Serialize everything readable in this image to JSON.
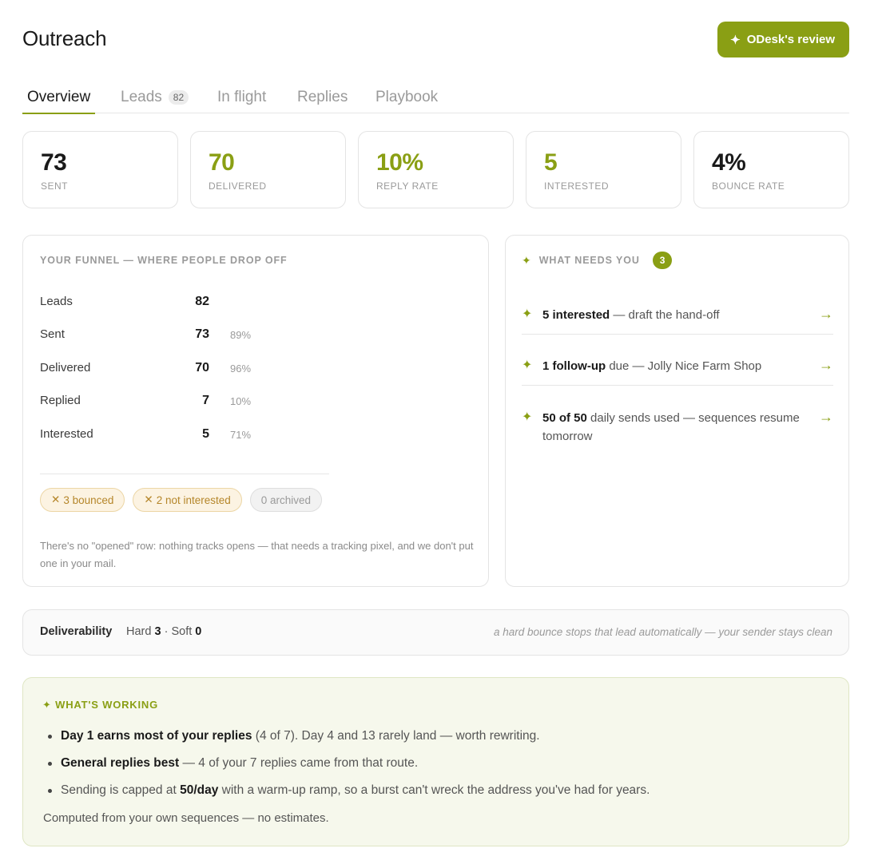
{
  "header": {
    "title": "Outreach",
    "review_button": {
      "icon": "sparkle-icon",
      "icon_glyph": "✦",
      "label": "ODesk's review"
    }
  },
  "tabs": [
    {
      "label": "Overview",
      "active": true
    },
    {
      "label": "Leads",
      "badge": "82"
    },
    {
      "label": "In flight"
    },
    {
      "label": "Replies"
    },
    {
      "label": "Playbook"
    }
  ],
  "stats": [
    {
      "value": "73",
      "label": "SENT",
      "accent": false
    },
    {
      "value": "70",
      "label": "DELIVERED",
      "accent": true
    },
    {
      "value": "10%",
      "label": "REPLY RATE",
      "accent": true
    },
    {
      "value": "5",
      "label": "INTERESTED",
      "accent": true
    },
    {
      "value": "4%",
      "label": "BOUNCE RATE",
      "accent": false
    }
  ],
  "funnel": {
    "title": "YOUR FUNNEL — WHERE PEOPLE DROP OFF",
    "rows": [
      {
        "label": "Leads",
        "value": "82",
        "pct": ""
      },
      {
        "label": "Sent",
        "value": "73",
        "pct": "89%"
      },
      {
        "label": "Delivered",
        "value": "70",
        "pct": "96%"
      },
      {
        "label": "Replied",
        "value": "7",
        "pct": "10%"
      },
      {
        "label": "Interested",
        "value": "5",
        "pct": "71%"
      }
    ],
    "chips": [
      {
        "icon": "x-icon",
        "icon_glyph": "✕",
        "label": "3 bounced"
      },
      {
        "icon": "x-icon",
        "icon_glyph": "✕",
        "label": "2 not interested"
      },
      {
        "label": "0 archived"
      }
    ],
    "note": "There's no \"opened\" row: nothing tracks opens — that needs a tracking pixel, and we don't put one in your mail."
  },
  "needs": {
    "icon_glyph": "✦",
    "title": "WHAT NEEDS YOU",
    "count": "3",
    "arrow_glyph": "→",
    "items": [
      {
        "bold": "5 interested",
        "rest": " — draft the hand-off"
      },
      {
        "bold": "1 follow-up",
        "rest": " due — Jolly Nice Farm Shop"
      },
      {
        "bold": "50 of 50",
        "rest": " daily sends used — sequences resume tomorrow"
      }
    ]
  },
  "deliverability": {
    "title": "Deliverability",
    "hard_label": "Hard",
    "hard_value": "3",
    "separator": "·",
    "soft_label": "Soft",
    "soft_value": "0",
    "note": "a hard bounce stops that lead automatically — your sender stays clean"
  },
  "working": {
    "icon_glyph": "✦",
    "title": "WHAT'S WORKING",
    "items": [
      {
        "bold": "Day 1 earns most of your replies",
        "rest": " (4 of 7). Day 4 and 13 rarely land — worth rewriting."
      },
      {
        "bold": "General replies best",
        "rest": " — 4 of your 7 replies came from that route."
      },
      {
        "pre": "Sending is capped at ",
        "bold": "50/day",
        "rest": " with a warm-up ramp, so a burst can't wreck the address you've had for years."
      }
    ],
    "footer": "Computed from your own sequences — no estimates."
  },
  "colors": {
    "accent": "#8a9f14",
    "warn_chip_bg": "#fcf3e2",
    "warn_chip_text": "#b5862a",
    "working_bg": "#f6f8ec"
  }
}
